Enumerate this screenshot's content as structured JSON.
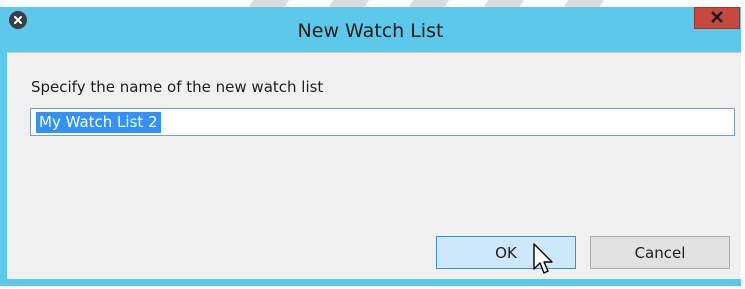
{
  "dialog": {
    "title": "New Watch List",
    "close_icon": "close-x-icon",
    "app_icon": "close-circle-icon"
  },
  "form": {
    "prompt": "Specify the name of the new watch list",
    "name_value": "My Watch List 2",
    "name_selected": true
  },
  "buttons": {
    "ok_label": "OK",
    "cancel_label": "Cancel"
  },
  "colors": {
    "title_bar": "#5cc8ea",
    "close_button": "#c7483f",
    "selection": "#3390ff",
    "ok_button": "#cde8fb"
  }
}
